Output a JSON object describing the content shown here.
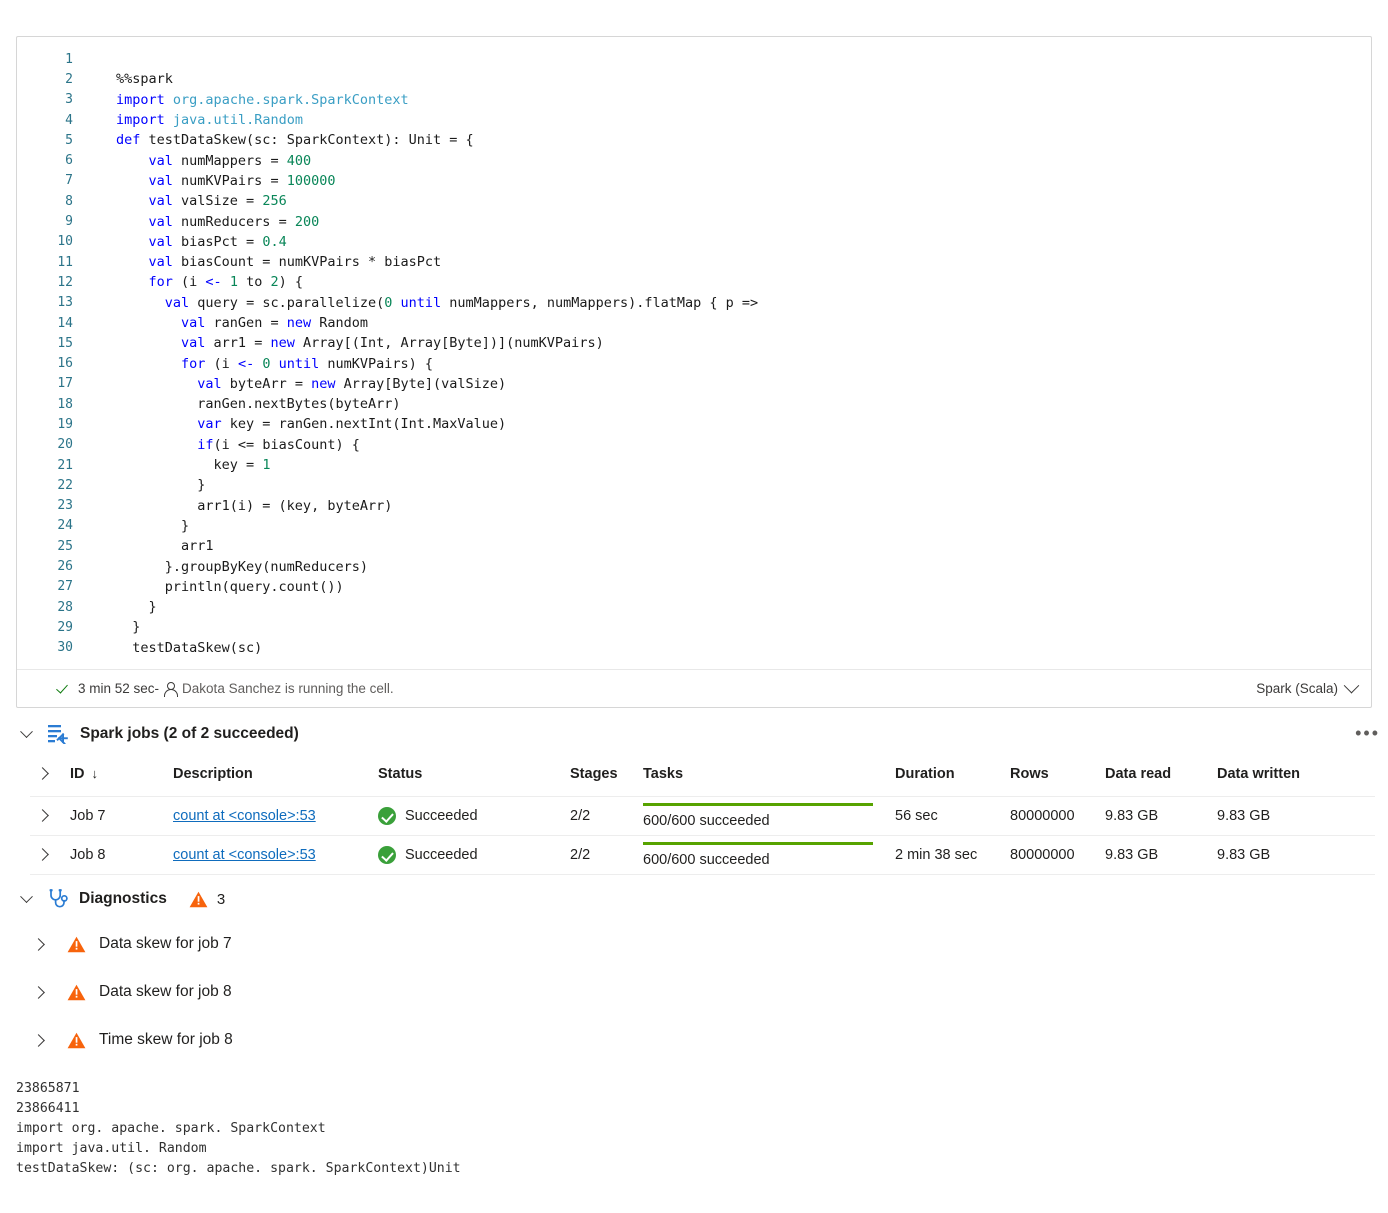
{
  "cell": {
    "language": "Spark (Scala)",
    "status_duration": "3 min 52 sec",
    "status_separator": " - ",
    "runner_text": "Dakota Sanchez is running the cell.",
    "lines": [
      {
        "n": "1",
        "tokens": []
      },
      {
        "n": "2",
        "tokens": [
          {
            "t": "%%spark",
            "c": "plain"
          }
        ]
      },
      {
        "n": "3",
        "tokens": [
          {
            "t": "import",
            "c": "kw"
          },
          {
            "t": " ",
            "c": "plain"
          },
          {
            "t": "org.apache.spark.SparkContext",
            "c": "pkg"
          }
        ]
      },
      {
        "n": "4",
        "tokens": [
          {
            "t": "import",
            "c": "kw"
          },
          {
            "t": " ",
            "c": "plain"
          },
          {
            "t": "java.util.Random",
            "c": "pkg"
          }
        ]
      },
      {
        "n": "5",
        "tokens": [
          {
            "t": "def",
            "c": "kw"
          },
          {
            "t": " testDataSkew(sc: SparkContext): Unit = {",
            "c": "plain"
          }
        ]
      },
      {
        "n": "6",
        "tokens": [
          {
            "t": "    ",
            "c": "plain"
          },
          {
            "t": "val",
            "c": "kw"
          },
          {
            "t": " numMappers = ",
            "c": "plain"
          },
          {
            "t": "400",
            "c": "num"
          }
        ]
      },
      {
        "n": "7",
        "tokens": [
          {
            "t": "    ",
            "c": "plain"
          },
          {
            "t": "val",
            "c": "kw"
          },
          {
            "t": " numKVPairs = ",
            "c": "plain"
          },
          {
            "t": "100000",
            "c": "num"
          }
        ]
      },
      {
        "n": "8",
        "tokens": [
          {
            "t": "    ",
            "c": "plain"
          },
          {
            "t": "val",
            "c": "kw"
          },
          {
            "t": " valSize = ",
            "c": "plain"
          },
          {
            "t": "256",
            "c": "num"
          }
        ]
      },
      {
        "n": "9",
        "tokens": [
          {
            "t": "    ",
            "c": "plain"
          },
          {
            "t": "val",
            "c": "kw"
          },
          {
            "t": " numReducers = ",
            "c": "plain"
          },
          {
            "t": "200",
            "c": "num"
          }
        ]
      },
      {
        "n": "10",
        "tokens": [
          {
            "t": "    ",
            "c": "plain"
          },
          {
            "t": "val",
            "c": "kw"
          },
          {
            "t": " biasPct = ",
            "c": "plain"
          },
          {
            "t": "0.4",
            "c": "num"
          }
        ]
      },
      {
        "n": "11",
        "tokens": [
          {
            "t": "    ",
            "c": "plain"
          },
          {
            "t": "val",
            "c": "kw"
          },
          {
            "t": " biasCount = numKVPairs * biasPct",
            "c": "plain"
          }
        ]
      },
      {
        "n": "12",
        "tokens": [
          {
            "t": "    ",
            "c": "plain"
          },
          {
            "t": "for",
            "c": "kw"
          },
          {
            "t": " (i ",
            "c": "plain"
          },
          {
            "t": "<-",
            "c": "kw"
          },
          {
            "t": " ",
            "c": "plain"
          },
          {
            "t": "1",
            "c": "num"
          },
          {
            "t": " to ",
            "c": "plain"
          },
          {
            "t": "2",
            "c": "num"
          },
          {
            "t": ") {",
            "c": "plain"
          }
        ]
      },
      {
        "n": "13",
        "tokens": [
          {
            "t": "      ",
            "c": "plain"
          },
          {
            "t": "val",
            "c": "kw"
          },
          {
            "t": " query = sc.parallelize(",
            "c": "plain"
          },
          {
            "t": "0",
            "c": "num"
          },
          {
            "t": " ",
            "c": "plain"
          },
          {
            "t": "until",
            "c": "kw"
          },
          {
            "t": " numMappers, numMappers).flatMap { p =>",
            "c": "plain"
          }
        ]
      },
      {
        "n": "14",
        "tokens": [
          {
            "t": "        ",
            "c": "plain"
          },
          {
            "t": "val",
            "c": "kw"
          },
          {
            "t": " ranGen = ",
            "c": "plain"
          },
          {
            "t": "new",
            "c": "kw"
          },
          {
            "t": " Random",
            "c": "plain"
          }
        ]
      },
      {
        "n": "15",
        "tokens": [
          {
            "t": "        ",
            "c": "plain"
          },
          {
            "t": "val",
            "c": "kw"
          },
          {
            "t": " arr1 = ",
            "c": "plain"
          },
          {
            "t": "new",
            "c": "kw"
          },
          {
            "t": " Array[(Int, Array[Byte])](numKVPairs)",
            "c": "plain"
          }
        ]
      },
      {
        "n": "16",
        "tokens": [
          {
            "t": "        ",
            "c": "plain"
          },
          {
            "t": "for",
            "c": "kw"
          },
          {
            "t": " (i ",
            "c": "plain"
          },
          {
            "t": "<-",
            "c": "kw"
          },
          {
            "t": " ",
            "c": "plain"
          },
          {
            "t": "0",
            "c": "num"
          },
          {
            "t": " ",
            "c": "plain"
          },
          {
            "t": "until",
            "c": "kw"
          },
          {
            "t": " numKVPairs) {",
            "c": "plain"
          }
        ]
      },
      {
        "n": "17",
        "tokens": [
          {
            "t": "          ",
            "c": "plain"
          },
          {
            "t": "val",
            "c": "kw"
          },
          {
            "t": " byteArr = ",
            "c": "plain"
          },
          {
            "t": "new",
            "c": "kw"
          },
          {
            "t": " Array[Byte](valSize)",
            "c": "plain"
          }
        ]
      },
      {
        "n": "18",
        "tokens": [
          {
            "t": "          ranGen.nextBytes(byteArr)",
            "c": "plain"
          }
        ]
      },
      {
        "n": "19",
        "tokens": [
          {
            "t": "          ",
            "c": "plain"
          },
          {
            "t": "var",
            "c": "kw"
          },
          {
            "t": " key = ranGen.nextInt(Int.MaxValue)",
            "c": "plain"
          }
        ]
      },
      {
        "n": "20",
        "tokens": [
          {
            "t": "          ",
            "c": "plain"
          },
          {
            "t": "if",
            "c": "kw"
          },
          {
            "t": "(i <= biasCount) {",
            "c": "plain"
          }
        ]
      },
      {
        "n": "21",
        "tokens": [
          {
            "t": "            key = ",
            "c": "plain"
          },
          {
            "t": "1",
            "c": "num"
          }
        ]
      },
      {
        "n": "22",
        "tokens": [
          {
            "t": "          }",
            "c": "plain"
          }
        ]
      },
      {
        "n": "23",
        "tokens": [
          {
            "t": "          arr1(i) = (key, byteArr)",
            "c": "plain"
          }
        ]
      },
      {
        "n": "24",
        "tokens": [
          {
            "t": "        }",
            "c": "plain"
          }
        ]
      },
      {
        "n": "25",
        "tokens": [
          {
            "t": "        arr1",
            "c": "plain"
          }
        ]
      },
      {
        "n": "26",
        "tokens": [
          {
            "t": "      }.groupByKey(numReducers)",
            "c": "plain"
          }
        ]
      },
      {
        "n": "27",
        "tokens": [
          {
            "t": "      println(query.count())",
            "c": "plain"
          }
        ]
      },
      {
        "n": "28",
        "tokens": [
          {
            "t": "    }",
            "c": "plain"
          }
        ]
      },
      {
        "n": "29",
        "tokens": [
          {
            "t": "  }",
            "c": "plain"
          }
        ]
      },
      {
        "n": "30",
        "tokens": [
          {
            "t": "  testDataSkew(sc)",
            "c": "plain"
          }
        ]
      }
    ]
  },
  "spark_jobs": {
    "title": "Spark jobs (2 of 2 succeeded)",
    "icon": "spark-jobs-icon",
    "more_label": "•••",
    "columns": [
      "ID",
      "Description",
      "Status",
      "Stages",
      "Tasks",
      "Duration",
      "Rows",
      "Data read",
      "Data written"
    ],
    "sort_indicator": "↓",
    "rows": [
      {
        "id": "Job 7",
        "description": "count at <console>:53",
        "status": "Succeeded",
        "stages": "2/2",
        "tasks": "600/600 succeeded",
        "tasks_pct": 100,
        "duration": "56 sec",
        "rows": "80000000",
        "data_read": "9.83 GB",
        "data_written": "9.83 GB"
      },
      {
        "id": "Job 8",
        "description": "count at <console>:53",
        "status": "Succeeded",
        "stages": "2/2",
        "tasks": "600/600 succeeded",
        "tasks_pct": 100,
        "duration": "2 min 38 sec",
        "rows": "80000000",
        "data_read": "9.83 GB",
        "data_written": "9.83 GB"
      }
    ]
  },
  "diagnostics": {
    "title": "Diagnostics",
    "warning_count": "3",
    "items": [
      {
        "label": "Data skew for job 7"
      },
      {
        "label": "Data skew for job 8"
      },
      {
        "label": "Time skew for job 8"
      }
    ]
  },
  "output": {
    "lines": [
      "23865871",
      "23866411",
      "import org. apache. spark. SparkContext",
      "import java.util. Random",
      "testDataSkew: (sc: org. apache. spark. SparkContext)Unit"
    ]
  },
  "colors": {
    "keyword": "#0000ff",
    "package": "#3a9ec4",
    "number": "#098658",
    "link": "#0f6cbd",
    "success_green": "#3aa03a",
    "progress_green": "#57a300",
    "warning_orange": "#f7630c",
    "accent_blue": "#2b7cd3"
  }
}
